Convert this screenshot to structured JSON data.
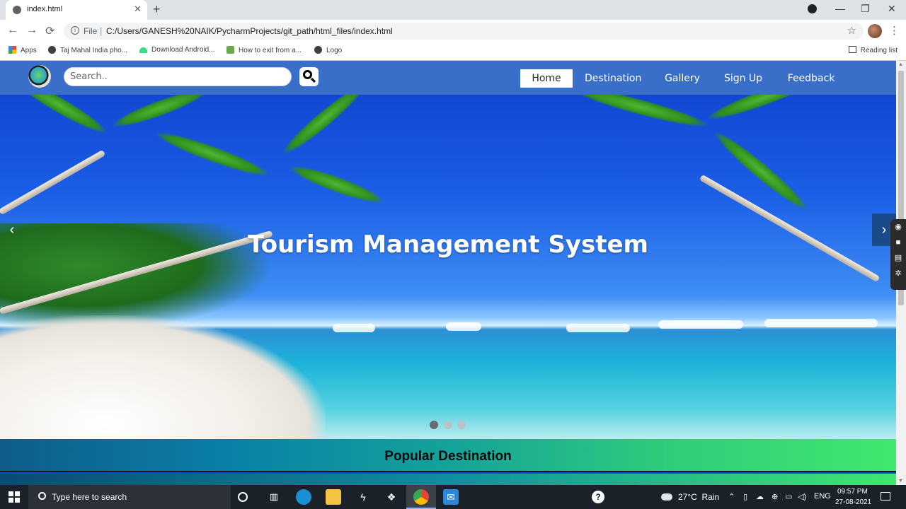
{
  "browser": {
    "tab_title": "index.html",
    "tab_close": "✕",
    "new_tab": "+",
    "window_controls": {
      "minimize": "—",
      "maximize": "❐",
      "close": "✕"
    },
    "back": "←",
    "forward": "→",
    "reload": "⟳",
    "url_scheme": "File",
    "url_separator": "|",
    "url": "C:/Users/GANESH%20NAIK/PycharmProjects/git_path/html_files/index.html",
    "star": "☆",
    "kebab": "⋮",
    "bookmarks": [
      {
        "label": "Apps",
        "icon": "apps-grid-icon"
      },
      {
        "label": "Taj Mahal India pho...",
        "icon": "globe-icon"
      },
      {
        "label": "Download Android...",
        "icon": "android-icon"
      },
      {
        "label": "How to exit from a...",
        "icon": "hexagon-icon"
      },
      {
        "label": "Logo",
        "icon": "globe-icon"
      }
    ],
    "reading_list": "Reading list"
  },
  "site": {
    "search_placeholder": "Search..",
    "nav": {
      "home": "Home",
      "destination": "Destination",
      "gallery": "Gallery",
      "signup": "Sign Up",
      "feedback": "Feedback"
    },
    "hero_title": "Tourism Management System",
    "carousel": {
      "prev": "‹",
      "next": "›",
      "slides": 3,
      "active_slide": 1
    },
    "section_title": "Popular Destination"
  },
  "side_widget": {
    "icons": [
      "pin-icon",
      "camera-icon",
      "video-icon",
      "gallery-icon",
      "gear-icon"
    ]
  },
  "taskbar": {
    "search_placeholder": "Type here to search",
    "weather_temp": "27°C",
    "weather_text": "Rain",
    "language": "ENG",
    "time": "09:57 PM",
    "date": "27-08-2021",
    "help": "?"
  },
  "colors": {
    "header_bg": "#3a6fc9",
    "nav_active_bg": "#ffffff",
    "section_gradient_start": "#0f5c8a",
    "section_gradient_end": "#3fe86e"
  }
}
